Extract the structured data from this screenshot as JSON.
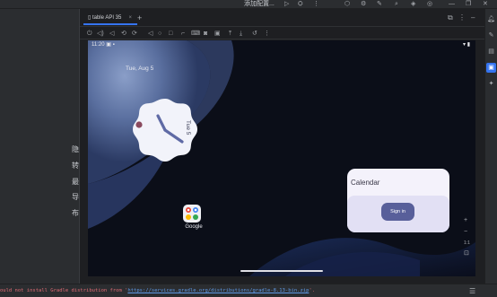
{
  "topbar": {
    "config_label": "添加配置...",
    "icons": [
      "run-icon",
      "debug-icon",
      "more-icon",
      "mirror-icon",
      "settings-icon",
      "ai-icon",
      "search-icon",
      "layers-icon",
      "account-icon",
      "minimize-icon",
      "restore-icon",
      "close-icon"
    ]
  },
  "left_panel": {
    "labels": [
      "隐",
      "转",
      "最",
      "导",
      "布"
    ]
  },
  "device_tab": {
    "label": "table API 35",
    "close": "×",
    "add": "+"
  },
  "screen": {
    "status_time": "11:20",
    "date": "Tue, Aug 5",
    "clock_label": "Tue 5",
    "app_label": "Google",
    "widget_title": "Calendar",
    "signin_label": "Sign in"
  },
  "zoom": {
    "plus": "+",
    "minus": "−",
    "ratio": "1:1",
    "fit": "⊡"
  },
  "console": {
    "message_prefix": "ould not install Gradle distribution from '",
    "link": "https://services.gradle.org/distributions/gradle-8.13-bin.zip",
    "message_suffix": "'."
  }
}
